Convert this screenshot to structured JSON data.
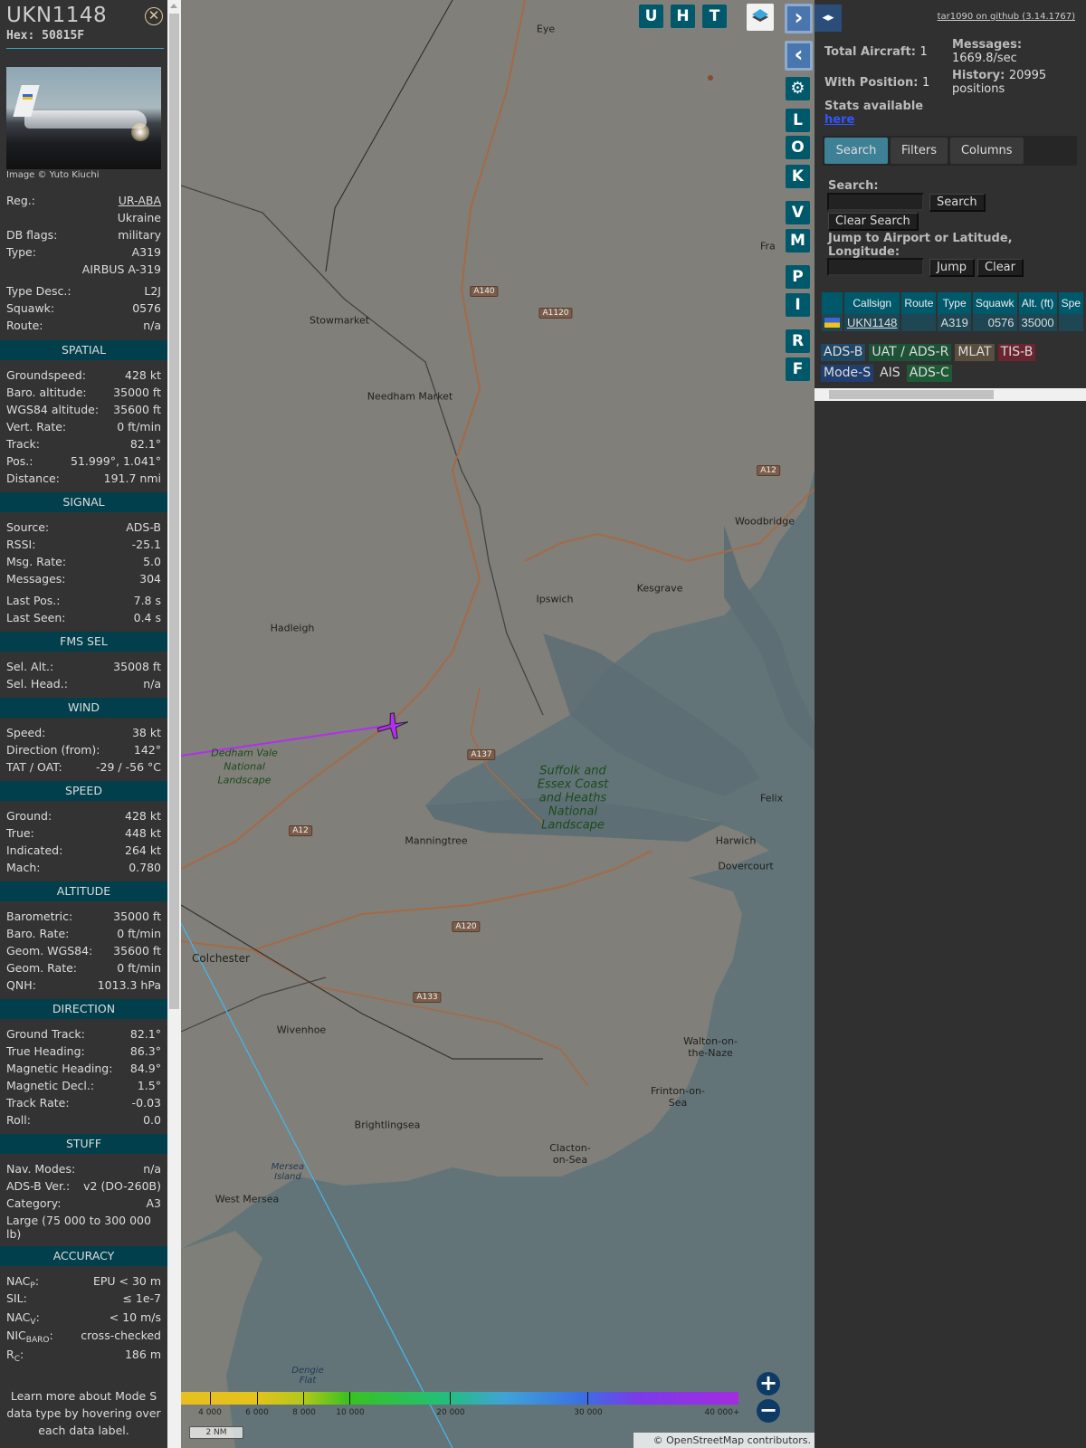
{
  "aircraft": {
    "callsign": "UKN1148",
    "hex_label": "Hex: 50815F",
    "photo_credit": "Image © Yuto Kiuchi",
    "info": [
      {
        "label": "Reg.:",
        "value": "UR-ABA"
      },
      {
        "label": "",
        "value": "Ukraine"
      },
      {
        "label": "DB flags:",
        "value": "military"
      },
      {
        "label": "Type:",
        "value": "A319"
      },
      {
        "label": "",
        "value": "AIRBUS A-319"
      },
      {
        "label": "Type Desc.:",
        "value": "L2J"
      },
      {
        "label": "Squawk:",
        "value": "0576"
      },
      {
        "label": "Route:",
        "value": "n/a"
      }
    ]
  },
  "sections": {
    "spatial": {
      "title": "SPATIAL",
      "rows": [
        {
          "label": "Groundspeed:",
          "value": "428 kt"
        },
        {
          "label": "Baro. altitude:",
          "value": "35000 ft"
        },
        {
          "label": "WGS84 altitude:",
          "value": "35600 ft"
        },
        {
          "label": "Vert. Rate:",
          "value": "0 ft/min"
        },
        {
          "label": "Track:",
          "value": "82.1°"
        },
        {
          "label": "Pos.:",
          "value": "51.999°, 1.041°"
        },
        {
          "label": "Distance:",
          "value": "191.7 nmi"
        }
      ]
    },
    "signal": {
      "title": "SIGNAL",
      "rows": [
        {
          "label": "Source:",
          "value": "ADS-B"
        },
        {
          "label": "RSSI:",
          "value": "-25.1"
        },
        {
          "label": "Msg. Rate:",
          "value": "5.0"
        },
        {
          "label": "Messages:",
          "value": "304"
        },
        {
          "label": "Last Pos.:",
          "value": "7.8 s"
        },
        {
          "label": "Last Seen:",
          "value": "0.4 s"
        }
      ]
    },
    "fms": {
      "title": "FMS SEL",
      "rows": [
        {
          "label": "Sel. Alt.:",
          "value": "35008 ft"
        },
        {
          "label": "Sel. Head.:",
          "value": "n/a"
        }
      ]
    },
    "wind": {
      "title": "WIND",
      "rows": [
        {
          "label": "Speed:",
          "value": "38 kt"
        },
        {
          "label": "Direction (from):",
          "value": "142°"
        },
        {
          "label": "TAT / OAT:",
          "value": "-29 / -56 °C"
        }
      ]
    },
    "speed": {
      "title": "SPEED",
      "rows": [
        {
          "label": "Ground:",
          "value": "428 kt"
        },
        {
          "label": "True:",
          "value": "448 kt"
        },
        {
          "label": "Indicated:",
          "value": "264 kt"
        },
        {
          "label": "Mach:",
          "value": "0.780"
        }
      ]
    },
    "altitude": {
      "title": "ALTITUDE",
      "rows": [
        {
          "label": "Barometric:",
          "value": "35000 ft"
        },
        {
          "label": "Baro. Rate:",
          "value": "0 ft/min"
        },
        {
          "label": "Geom. WGS84:",
          "value": "35600 ft"
        },
        {
          "label": "Geom. Rate:",
          "value": "0 ft/min"
        },
        {
          "label": "QNH:",
          "value": "1013.3 hPa"
        }
      ]
    },
    "direction": {
      "title": "DIRECTION",
      "rows": [
        {
          "label": "Ground Track:",
          "value": "82.1°"
        },
        {
          "label": "True Heading:",
          "value": "86.3°"
        },
        {
          "label": "Magnetic Heading:",
          "value": "84.9°"
        },
        {
          "label": "Magnetic Decl.:",
          "value": "1.5°"
        },
        {
          "label": "Track Rate:",
          "value": "-0.03"
        },
        {
          "label": "Roll:",
          "value": "0.0"
        }
      ]
    },
    "stuff": {
      "title": "STUFF",
      "rows": [
        {
          "label": "Nav. Modes:",
          "value": "n/a"
        },
        {
          "label": "ADS-B Ver.:",
          "value": "v2 (DO-260B)"
        },
        {
          "label": "Category:",
          "value": "A3"
        }
      ],
      "category_desc": "Large (75 000 to 300 000 lb)"
    },
    "accuracy": {
      "title": "ACCURACY",
      "rows": [
        {
          "label": "NAC",
          "sub": "P",
          "value": "EPU < 30 m"
        },
        {
          "label": "SIL",
          "sub": "",
          "value": "≤ 1e-7"
        },
        {
          "label": "NAC",
          "sub": "V",
          "value": "< 10 m/s"
        },
        {
          "label": "NIC",
          "sub": "BARO",
          "value": "cross-checked"
        },
        {
          "label": "R",
          "sub": "C",
          "value": "186 m"
        }
      ]
    },
    "learn_more": "Learn more about Mode S data type by hovering over each data label."
  },
  "map": {
    "towns": [
      "Eye",
      "Stowmarket",
      "Needham Market",
      "Hadleigh",
      "Ipswich",
      "Kesgrave",
      "Woodbridge",
      "Manningtree",
      "Harwich",
      "Dovercourt",
      "Colchester",
      "Wivenhoe",
      "Walton-on-the-Naze",
      "Frinton-on-Sea",
      "Brightlingsea",
      "Clacton-on-Sea",
      "West Mersea",
      "Felix",
      "Fra"
    ],
    "parks": [
      "Dedham Vale National Landscape",
      "Suffolk and Essex Coast and Heaths National Landscape"
    ],
    "water": [
      "Mersea Island",
      "Dengie Flat"
    ],
    "roads": [
      "A140",
      "A1120",
      "A12",
      "A137",
      "A12",
      "A120",
      "A133"
    ],
    "overlay_buttons": [
      "U",
      "H",
      "T"
    ],
    "side_buttons": [
      "L",
      "O",
      "K",
      "V",
      "M",
      "P",
      "I",
      "R",
      "F"
    ],
    "colorbar_labels": [
      "4 000",
      "6 000",
      "8 000",
      "10 000",
      "20 000",
      "30 000",
      "40 000+"
    ],
    "scale": "2 NM",
    "attribution_prefix": "©",
    "attribution_link": "OpenStreetMap",
    "attribution_suffix": "contributors."
  },
  "panel": {
    "github_link": "tar1090 on github (3.14.1767)",
    "total_aircraft_label": "Total Aircraft:",
    "total_aircraft": "1",
    "with_position_label": "With Position:",
    "with_position": "1",
    "stats_label": "Stats available",
    "stats_link": "here",
    "messages_label": "Messages:",
    "messages_rate": "1669.8/sec",
    "history_label": "History:",
    "history_value": "20995",
    "history_unit": "positions",
    "tabs": [
      "Search",
      "Filters",
      "Columns"
    ],
    "search_label": "Search:",
    "search_value": "",
    "search_button": "Search",
    "clear_search_button": "Clear Search",
    "jump_label": "Jump to Airport or Latitude, Longitude:",
    "jump_value": "",
    "jump_button": "Jump",
    "clear_button": "Clear",
    "table": {
      "columns": [
        "",
        "Callsign",
        "Route",
        "Type",
        "Squawk",
        "Alt. (ft)",
        "Spe"
      ],
      "rows": [
        {
          "callsign": "UKN1148",
          "route": "",
          "type": "A319",
          "squawk": "0576",
          "alt": "35000",
          "speed": ""
        }
      ]
    },
    "badges": [
      {
        "label": "ADS-B",
        "color": "#1f4766"
      },
      {
        "label": "UAT / ADS-R",
        "color": "#1e5236"
      },
      {
        "label": "MLAT",
        "color": "#5a4e3e"
      },
      {
        "label": "TIS-B",
        "color": "#6a2530"
      },
      {
        "label": "Mode-S",
        "color": "#203e70"
      },
      {
        "label": "AIS",
        "color": "#303030"
      },
      {
        "label": "ADS-C",
        "color": "#1f5a37"
      }
    ]
  },
  "colors": {
    "header": "#003f4b",
    "button": "#00596b",
    "track": "#b22ef0",
    "plane": "#a52ef0"
  }
}
